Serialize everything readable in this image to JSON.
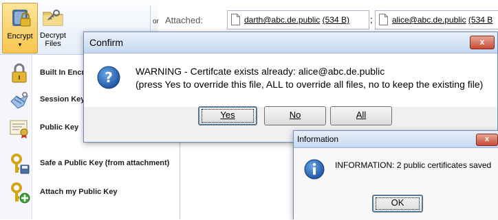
{
  "ribbon": {
    "encrypt": {
      "label": "Encrypt",
      "chevron": "▾",
      "icon": "lock-shield-icon"
    },
    "decrypt": {
      "label_line1": "Decrypt",
      "label_line2": "Files",
      "icon": "folder-key-icon"
    },
    "partial_text": "or"
  },
  "menu": {
    "items": [
      {
        "label": "Built In Encr",
        "icon": "padlock-icon"
      },
      {
        "label": "Session Key",
        "icon": "handshake-key-icon"
      },
      {
        "label": "Public Key",
        "icon": "certificate-icon"
      },
      {
        "label": "Safe a Public Key (from attachment)",
        "icon": "key-save-icon"
      },
      {
        "label": "Attach my Public Key",
        "icon": "key-add-icon"
      }
    ]
  },
  "compose": {
    "attached_label": "Attached:",
    "attachments": [
      {
        "name": "darth@abc.de.public",
        "size": "(534 B)"
      },
      {
        "name": "alice@abc.de.public",
        "size": "(534 B"
      }
    ],
    "separator": ";"
  },
  "confirm_dialog": {
    "title": "Confirm",
    "close_label": "x",
    "icon": "question-icon",
    "message_line1": "WARNING - Certifcate exists already: alice@abc.de.public",
    "message_line2": "(press Yes to override this file, ALL to override all files, no to keep the existing file)",
    "buttons": {
      "yes": "Yes",
      "no": "No",
      "all": "All"
    }
  },
  "info_dialog": {
    "title": "Information",
    "close_label": "x",
    "icon": "information-icon",
    "message": "INFORMATION: 2 public certificates saved",
    "ok_label": "OK"
  },
  "colors": {
    "accent": "#1f5ea8",
    "ribbon_selected": "#f7c54e",
    "close_red": "#c74c35"
  }
}
